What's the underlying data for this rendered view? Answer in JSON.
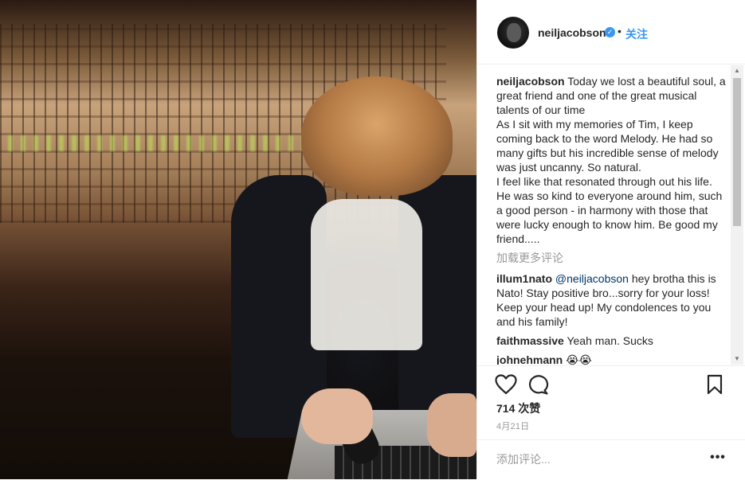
{
  "post": {
    "username": "neiljacobson",
    "dot": "•",
    "follow_label": "关注",
    "verified_glyph": "✓"
  },
  "comments": [
    {
      "user": "neiljacobson",
      "lines": [
        "Today we lost a beautiful soul, a great friend and one of the great musical talents of our time",
        "As I sit with my memories of Tim, I keep coming back to the word Melody. He had so many gifts but his incredible sense of melody was just uncanny. So natural.",
        "I feel like that resonated through out his life. He was so kind to everyone around him, such a good person - in harmony with those that were lucky enough to know him. Be good my friend....."
      ]
    },
    {
      "user": "illum1nato",
      "mention": "@neiljacobson",
      "text": "hey brotha this is Nato! Stay positive bro...sorry for your loss! Keep your head up! My condolences to you and his family!"
    },
    {
      "user": "faithmassive",
      "text": "Yeah man. Sucks"
    },
    {
      "user": "johnehmann",
      "text": "😭😭"
    }
  ],
  "load_more": "加载更多评论",
  "likes": "714 次赞",
  "date": "4月21日",
  "add_comment_placeholder": "添加评论...",
  "more_glyph": "•••",
  "icons": {
    "like": "heart-icon",
    "comment": "comment-icon",
    "save": "bookmark-icon",
    "more": "more-options-icon"
  },
  "colors": {
    "accent": "#3897f0",
    "text": "#262626",
    "muted": "#999999"
  }
}
